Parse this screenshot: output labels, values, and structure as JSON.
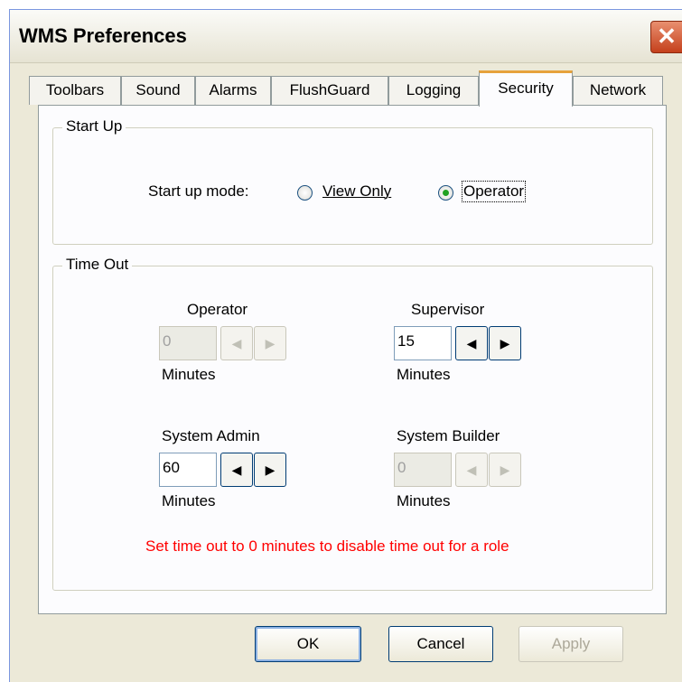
{
  "window": {
    "title": "WMS Preferences",
    "close_glyph": "✕"
  },
  "tabs": [
    {
      "label": "Toolbars",
      "active": false
    },
    {
      "label": "Sound",
      "active": false
    },
    {
      "label": "Alarms",
      "active": false
    },
    {
      "label": "FlushGuard",
      "active": false
    },
    {
      "label": "Logging",
      "active": false
    },
    {
      "label": "Security",
      "active": true
    },
    {
      "label": "Network",
      "active": false
    }
  ],
  "startup": {
    "group_title": "Start Up",
    "mode_label": "Start up mode:",
    "options": [
      {
        "label": "View Only",
        "checked": false
      },
      {
        "label": "Operator",
        "checked": true
      }
    ]
  },
  "timeout": {
    "group_title": "Time Out",
    "roles": [
      {
        "name": "Operator",
        "value": "0",
        "unit": "Minutes",
        "enabled": false
      },
      {
        "name": "Supervisor",
        "value": "15",
        "unit": "Minutes",
        "enabled": true
      },
      {
        "name": "System Admin",
        "value": "60",
        "unit": "Minutes",
        "enabled": true
      },
      {
        "name": "System Builder",
        "value": "0",
        "unit": "Minutes",
        "enabled": false
      }
    ],
    "note": "Set time out to 0 minutes to disable time out for a role",
    "note_color": "#ff0000",
    "spin_left_glyph": "◀",
    "spin_right_glyph": "▶"
  },
  "buttons": {
    "ok": "OK",
    "cancel": "Cancel",
    "apply": "Apply"
  }
}
